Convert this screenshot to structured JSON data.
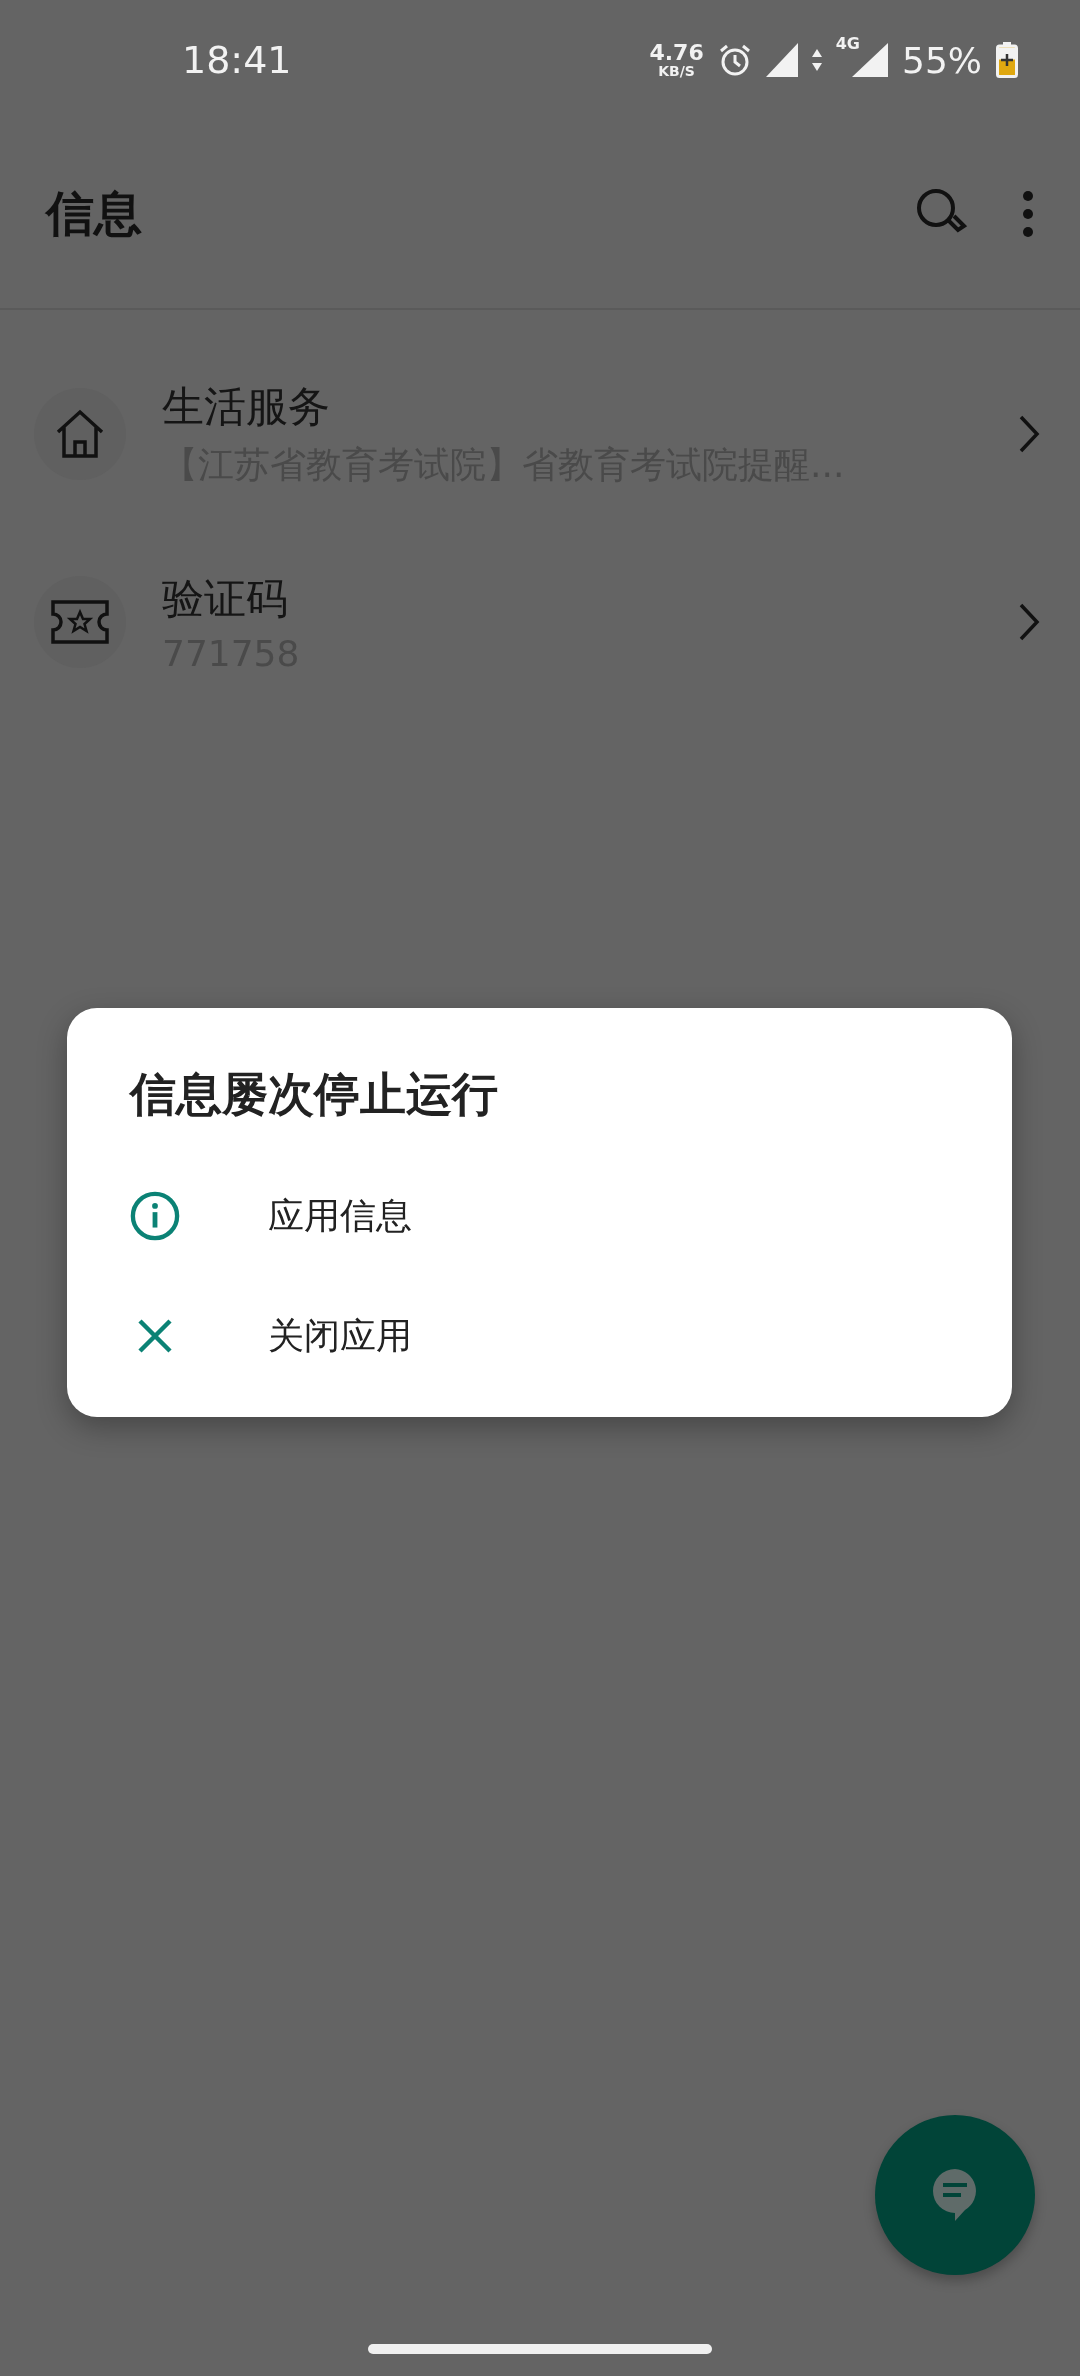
{
  "status_bar": {
    "time": "18:41",
    "net_speed": "4.76",
    "net_unit": "KB/S",
    "network": "4G",
    "battery": "55%"
  },
  "toolbar": {
    "title": "信息"
  },
  "conversations": [
    {
      "kind": "home",
      "title": "生活服务",
      "preview": "【江苏省教育考试院】省教育考试院提醒..."
    },
    {
      "kind": "ticket",
      "title": "验证码",
      "preview": "771758"
    }
  ],
  "dialog": {
    "title": "信息屡次停止运行",
    "actions": [
      {
        "kind": "info",
        "label": "应用信息"
      },
      {
        "kind": "close",
        "label": "关闭应用"
      }
    ]
  }
}
